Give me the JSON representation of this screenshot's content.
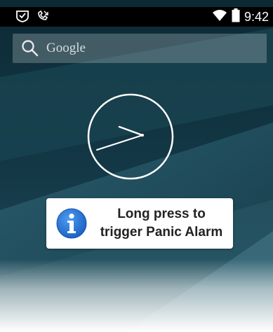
{
  "status_bar": {
    "left_icons": [
      "shield-check-icon",
      "phone-missed-icon"
    ],
    "right_icons": [
      "wifi-icon",
      "battery-icon"
    ],
    "time": "9:42"
  },
  "search": {
    "icon": "search-icon",
    "label": "Google"
  },
  "clock": {
    "type": "analog",
    "hands_time": "9:42"
  },
  "toast": {
    "icon": "info-icon",
    "line1": "Long press to",
    "line2": "trigger Panic Alarm",
    "icon_color": "#1e6fd9"
  },
  "colors": {
    "wallpaper_dark": "#0c2a35",
    "wallpaper_mid": "#1e4d5e",
    "wallpaper_light": "#3a6f80",
    "status_bar": "#000000",
    "toast_background": "#ffffff"
  }
}
